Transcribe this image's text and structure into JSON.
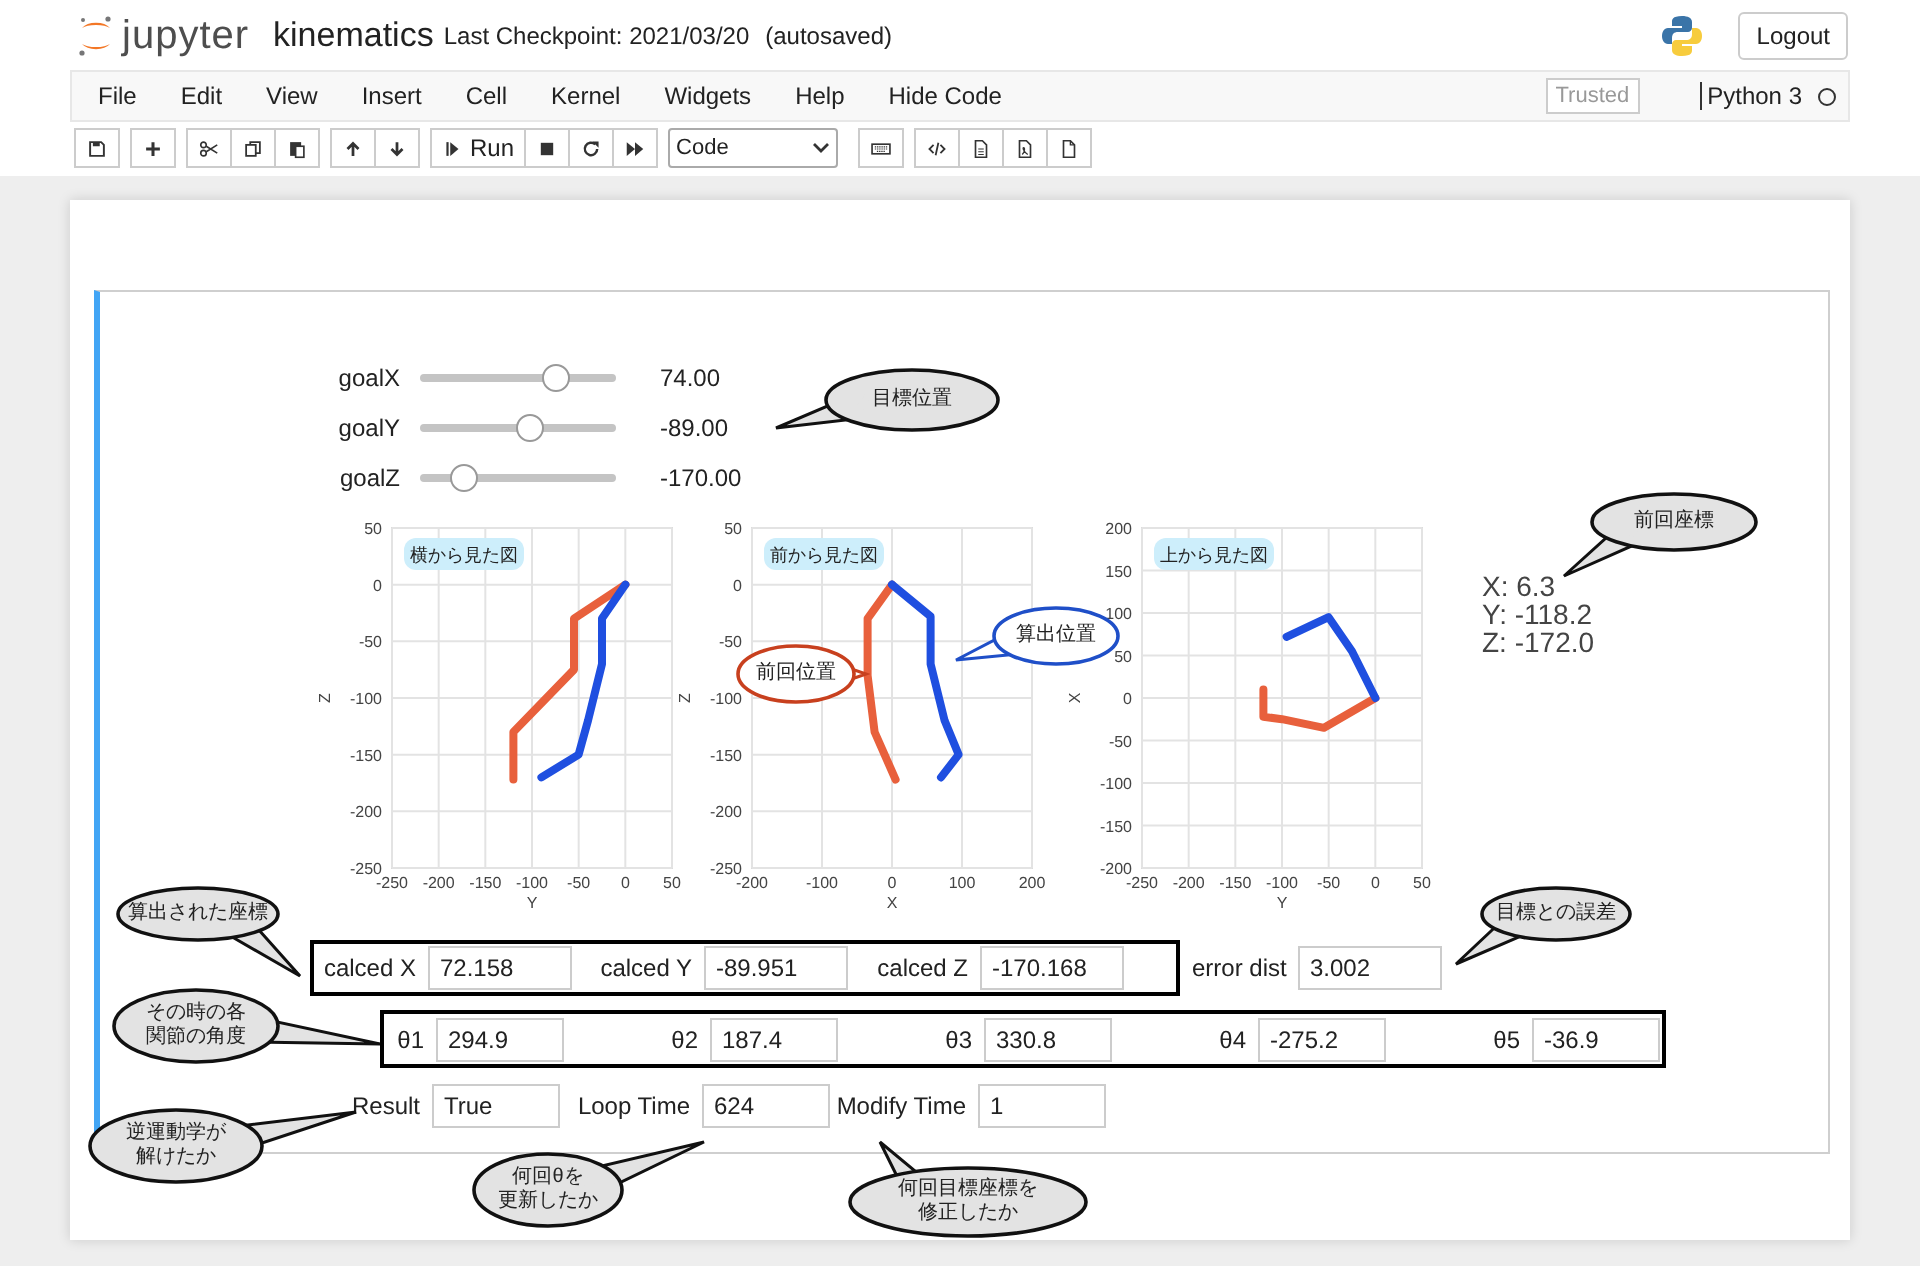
{
  "header": {
    "logo_text": "jupyter",
    "notebook_name": "kinematics",
    "checkpoint": "Last Checkpoint: 2021/03/20",
    "autosave": "(autosaved)",
    "logout": "Logout"
  },
  "menu": {
    "items": [
      "File",
      "Edit",
      "View",
      "Insert",
      "Cell",
      "Kernel",
      "Widgets",
      "Help",
      "Hide Code"
    ],
    "trusted": "Trusted",
    "kernel": "Python 3",
    "kernel_busy": false
  },
  "toolbar": {
    "run_label": "Run",
    "cell_type": "Code"
  },
  "sliders": [
    {
      "label": "goalX",
      "level": 0.69,
      "reading": "74.00"
    },
    {
      "label": "goalY",
      "level": 0.56,
      "reading": "-89.00"
    },
    {
      "label": "goalZ",
      "level": 0.22,
      "reading": "-170.00"
    }
  ],
  "charts": [
    {
      "chart_data": {
        "type": "line",
        "title": "横から見た図",
        "xlabel": "Y",
        "ylabel": "Z",
        "xlim": [
          -250,
          50
        ],
        "ylim": [
          -250,
          50
        ],
        "xticks": [
          -250,
          -200,
          -150,
          -100,
          -50,
          0,
          50
        ],
        "yticks": [
          -250,
          -200,
          -150,
          -100,
          -50,
          0,
          50
        ],
        "grid": true,
        "series": [
          {
            "color": "#e8603c",
            "x": [
              0,
              -55,
              -55,
              -120,
              -120
            ],
            "values": [
              0,
              -30,
              -75,
              -130,
              -172
            ]
          },
          {
            "color": "#1f4fe0",
            "x": [
              0,
              -25,
              -25,
              -40,
              -50,
              -90
            ],
            "values": [
              0,
              -30,
              -70,
              -120,
              -150,
              -170
            ]
          }
        ]
      }
    },
    {
      "chart_data": {
        "type": "line",
        "title": "前から見た図",
        "xlabel": "X",
        "ylabel": "Z",
        "xlim": [
          -200,
          200
        ],
        "ylim": [
          -250,
          50
        ],
        "xticks": [
          -200,
          -100,
          0,
          100,
          200
        ],
        "yticks": [
          -250,
          -200,
          -150,
          -100,
          -50,
          0,
          50
        ],
        "grid": true,
        "series": [
          {
            "color": "#e8603c",
            "x": [
              0,
              -35,
              -35,
              -25,
              5
            ],
            "values": [
              0,
              -30,
              -80,
              -130,
              -172
            ]
          },
          {
            "color": "#1f4fe0",
            "x": [
              0,
              55,
              55,
              75,
              95,
              70
            ],
            "values": [
              0,
              -28,
              -70,
              -120,
              -150,
              -170
            ]
          }
        ]
      }
    },
    {
      "chart_data": {
        "type": "line",
        "title": "上から見た図",
        "xlabel": "Y",
        "ylabel": "X",
        "xlim": [
          -250,
          50
        ],
        "ylim": [
          -200,
          200
        ],
        "xticks": [
          -250,
          -200,
          -150,
          -100,
          -50,
          0,
          50
        ],
        "yticks": [
          -200,
          -150,
          -100,
          -50,
          0,
          50,
          100,
          150,
          200
        ],
        "grid": true,
        "series": [
          {
            "color": "#e8603c",
            "x": [
              0,
              -55,
              -100,
              -120,
              -120
            ],
            "values": [
              0,
              -35,
              -25,
              -22,
              10
            ]
          },
          {
            "color": "#1f4fe0",
            "x": [
              0,
              -25,
              -50,
              -95
            ],
            "values": [
              0,
              55,
              95,
              72
            ]
          }
        ]
      }
    }
  ],
  "coordinates": [
    "X: 6.3",
    "Y: -118.2",
    "Z: -172.0"
  ],
  "calced": [
    {
      "label": "calced X",
      "value": "72.158"
    },
    {
      "label": "calced Y",
      "value": "-89.951"
    },
    {
      "label": "calced Z",
      "value": "-170.168"
    }
  ],
  "error": {
    "label": "error dist",
    "value": "3.002"
  },
  "angles": [
    {
      "label": "θ1",
      "value": "294.9"
    },
    {
      "label": "θ2",
      "value": "187.4"
    },
    {
      "label": "θ3",
      "value": "330.8"
    },
    {
      "label": "θ4",
      "value": "-275.2"
    },
    {
      "label": "θ5",
      "value": "-36.9"
    }
  ],
  "status": [
    {
      "label": "Result",
      "value": "True"
    },
    {
      "label": "Loop Time",
      "value": "624"
    },
    {
      "label": "Modify Time",
      "value": "1"
    }
  ],
  "callouts": [
    {
      "text": "目標位置",
      "kind": "note"
    },
    {
      "text": "前回座標",
      "kind": "note"
    },
    {
      "text": "算出位置",
      "kind": "calc"
    },
    {
      "text": "前回位置",
      "kind": "prev"
    },
    {
      "text": "算出された座標",
      "kind": "note"
    },
    {
      "text": "目標との誤差",
      "kind": "note"
    },
    {
      "lines": [
        "その時の各",
        "関節の角度"
      ],
      "kind": "note"
    },
    {
      "lines": [
        "逆運動学が",
        "解けたか"
      ],
      "kind": "note"
    },
    {
      "lines": [
        "何回θを",
        "更新したか"
      ],
      "kind": "note"
    },
    {
      "lines": [
        "何回目標座標を",
        "修正したか"
      ],
      "kind": "note"
    }
  ]
}
